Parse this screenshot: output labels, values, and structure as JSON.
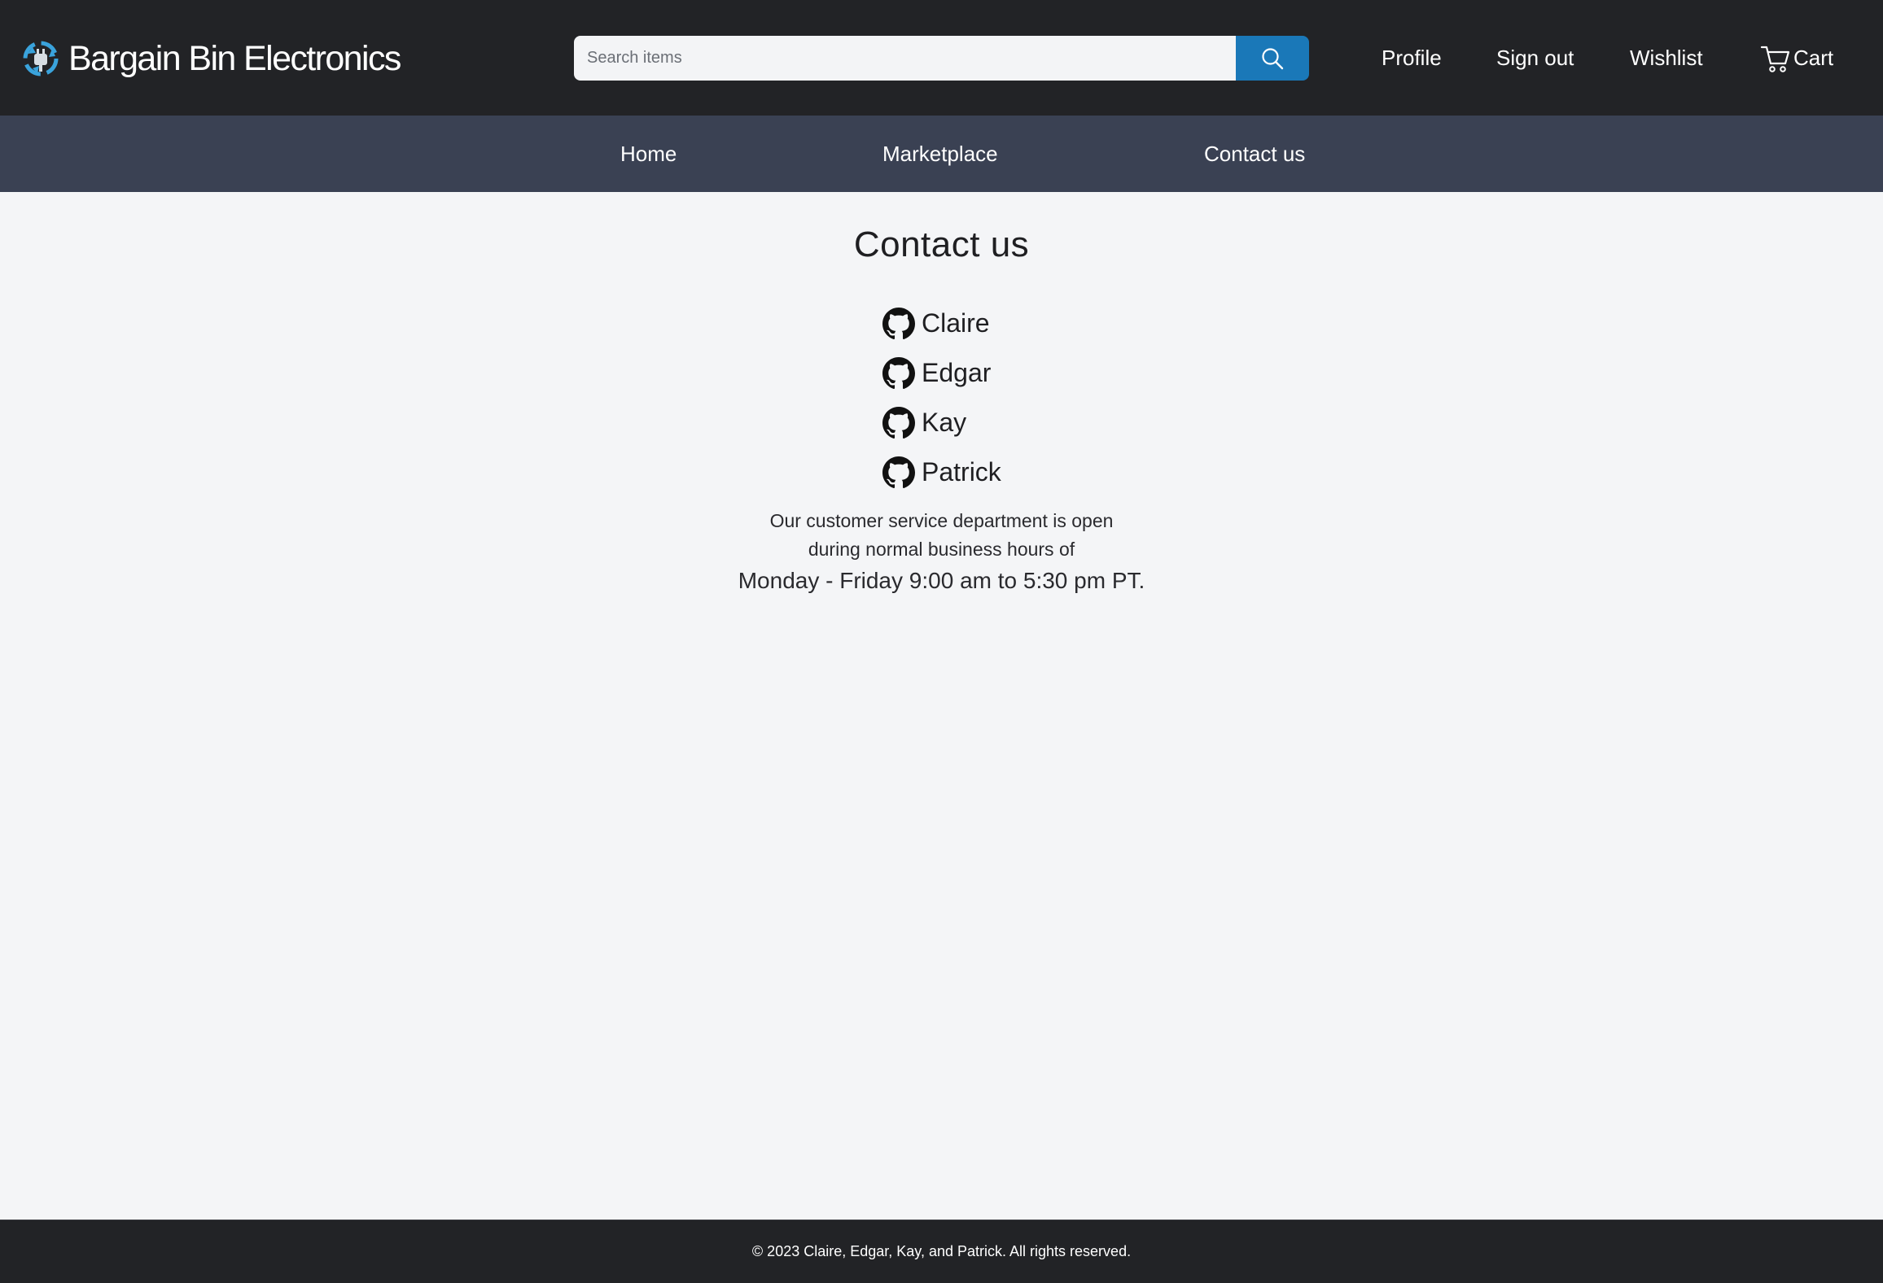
{
  "header": {
    "brand_name": "Bargain Bin Electronics",
    "logo_icon": "recycle-plug-logo",
    "search": {
      "placeholder": "Search items",
      "value": "",
      "button_icon": "search-icon"
    },
    "links": {
      "profile": "Profile",
      "sign_out": "Sign out",
      "wishlist": "Wishlist",
      "cart": "Cart"
    },
    "cart_icon": "cart-icon"
  },
  "nav": {
    "items": [
      {
        "label": "Home"
      },
      {
        "label": "Marketplace"
      },
      {
        "label": "Contact us"
      }
    ]
  },
  "main": {
    "title": "Contact us",
    "contacts": [
      {
        "name": "Claire",
        "icon": "github-icon"
      },
      {
        "name": "Edgar",
        "icon": "github-icon"
      },
      {
        "name": "Kay",
        "icon": "github-icon"
      },
      {
        "name": "Patrick",
        "icon": "github-icon"
      }
    ],
    "hours": {
      "line1": "Our customer service department is open",
      "line2": "during normal business hours of",
      "line3": "Monday - Friday 9:00 am to 5:30 pm PT."
    }
  },
  "footer": {
    "text": "© 2023 Claire, Edgar, Kay, and Patrick. All rights reserved."
  },
  "colors": {
    "header_bg": "#222326",
    "nav_bg": "#3a4153",
    "page_bg": "#f4f5f7",
    "search_button": "#1a78b8",
    "logo_accent": "#3aa3dc"
  }
}
